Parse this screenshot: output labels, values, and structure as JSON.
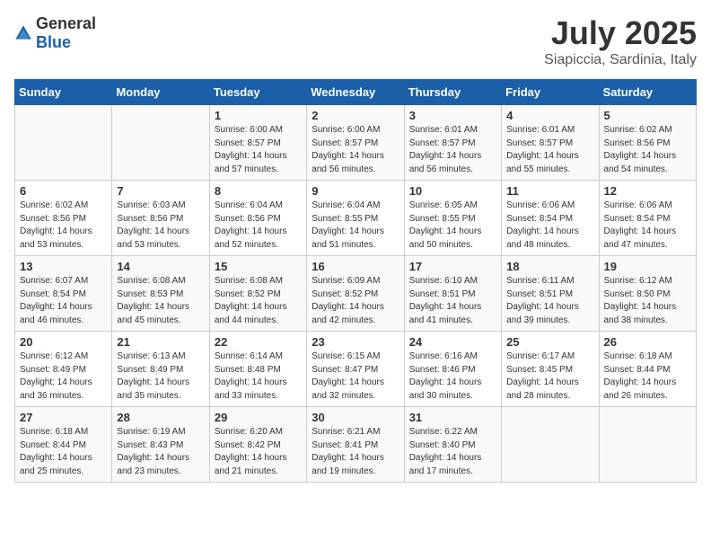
{
  "header": {
    "logo_general": "General",
    "logo_blue": "Blue",
    "month": "July 2025",
    "location": "Siapiccia, Sardinia, Italy"
  },
  "weekdays": [
    "Sunday",
    "Monday",
    "Tuesday",
    "Wednesday",
    "Thursday",
    "Friday",
    "Saturday"
  ],
  "weeks": [
    [
      {
        "day": "",
        "info": ""
      },
      {
        "day": "",
        "info": ""
      },
      {
        "day": "1",
        "sunrise": "6:00 AM",
        "sunset": "8:57 PM",
        "daylight": "14 hours and 57 minutes."
      },
      {
        "day": "2",
        "sunrise": "6:00 AM",
        "sunset": "8:57 PM",
        "daylight": "14 hours and 56 minutes."
      },
      {
        "day": "3",
        "sunrise": "6:01 AM",
        "sunset": "8:57 PM",
        "daylight": "14 hours and 56 minutes."
      },
      {
        "day": "4",
        "sunrise": "6:01 AM",
        "sunset": "8:57 PM",
        "daylight": "14 hours and 55 minutes."
      },
      {
        "day": "5",
        "sunrise": "6:02 AM",
        "sunset": "8:56 PM",
        "daylight": "14 hours and 54 minutes."
      }
    ],
    [
      {
        "day": "6",
        "sunrise": "6:02 AM",
        "sunset": "8:56 PM",
        "daylight": "14 hours and 53 minutes."
      },
      {
        "day": "7",
        "sunrise": "6:03 AM",
        "sunset": "8:56 PM",
        "daylight": "14 hours and 53 minutes."
      },
      {
        "day": "8",
        "sunrise": "6:04 AM",
        "sunset": "8:56 PM",
        "daylight": "14 hours and 52 minutes."
      },
      {
        "day": "9",
        "sunrise": "6:04 AM",
        "sunset": "8:55 PM",
        "daylight": "14 hours and 51 minutes."
      },
      {
        "day": "10",
        "sunrise": "6:05 AM",
        "sunset": "8:55 PM",
        "daylight": "14 hours and 50 minutes."
      },
      {
        "day": "11",
        "sunrise": "6:06 AM",
        "sunset": "8:54 PM",
        "daylight": "14 hours and 48 minutes."
      },
      {
        "day": "12",
        "sunrise": "6:06 AM",
        "sunset": "8:54 PM",
        "daylight": "14 hours and 47 minutes."
      }
    ],
    [
      {
        "day": "13",
        "sunrise": "6:07 AM",
        "sunset": "8:54 PM",
        "daylight": "14 hours and 46 minutes."
      },
      {
        "day": "14",
        "sunrise": "6:08 AM",
        "sunset": "8:53 PM",
        "daylight": "14 hours and 45 minutes."
      },
      {
        "day": "15",
        "sunrise": "6:08 AM",
        "sunset": "8:52 PM",
        "daylight": "14 hours and 44 minutes."
      },
      {
        "day": "16",
        "sunrise": "6:09 AM",
        "sunset": "8:52 PM",
        "daylight": "14 hours and 42 minutes."
      },
      {
        "day": "17",
        "sunrise": "6:10 AM",
        "sunset": "8:51 PM",
        "daylight": "14 hours and 41 minutes."
      },
      {
        "day": "18",
        "sunrise": "6:11 AM",
        "sunset": "8:51 PM",
        "daylight": "14 hours and 39 minutes."
      },
      {
        "day": "19",
        "sunrise": "6:12 AM",
        "sunset": "8:50 PM",
        "daylight": "14 hours and 38 minutes."
      }
    ],
    [
      {
        "day": "20",
        "sunrise": "6:12 AM",
        "sunset": "8:49 PM",
        "daylight": "14 hours and 36 minutes."
      },
      {
        "day": "21",
        "sunrise": "6:13 AM",
        "sunset": "8:49 PM",
        "daylight": "14 hours and 35 minutes."
      },
      {
        "day": "22",
        "sunrise": "6:14 AM",
        "sunset": "8:48 PM",
        "daylight": "14 hours and 33 minutes."
      },
      {
        "day": "23",
        "sunrise": "6:15 AM",
        "sunset": "8:47 PM",
        "daylight": "14 hours and 32 minutes."
      },
      {
        "day": "24",
        "sunrise": "6:16 AM",
        "sunset": "8:46 PM",
        "daylight": "14 hours and 30 minutes."
      },
      {
        "day": "25",
        "sunrise": "6:17 AM",
        "sunset": "8:45 PM",
        "daylight": "14 hours and 28 minutes."
      },
      {
        "day": "26",
        "sunrise": "6:18 AM",
        "sunset": "8:44 PM",
        "daylight": "14 hours and 26 minutes."
      }
    ],
    [
      {
        "day": "27",
        "sunrise": "6:18 AM",
        "sunset": "8:44 PM",
        "daylight": "14 hours and 25 minutes."
      },
      {
        "day": "28",
        "sunrise": "6:19 AM",
        "sunset": "8:43 PM",
        "daylight": "14 hours and 23 minutes."
      },
      {
        "day": "29",
        "sunrise": "6:20 AM",
        "sunset": "8:42 PM",
        "daylight": "14 hours and 21 minutes."
      },
      {
        "day": "30",
        "sunrise": "6:21 AM",
        "sunset": "8:41 PM",
        "daylight": "14 hours and 19 minutes."
      },
      {
        "day": "31",
        "sunrise": "6:22 AM",
        "sunset": "8:40 PM",
        "daylight": "14 hours and 17 minutes."
      },
      {
        "day": "",
        "info": ""
      },
      {
        "day": "",
        "info": ""
      }
    ]
  ]
}
